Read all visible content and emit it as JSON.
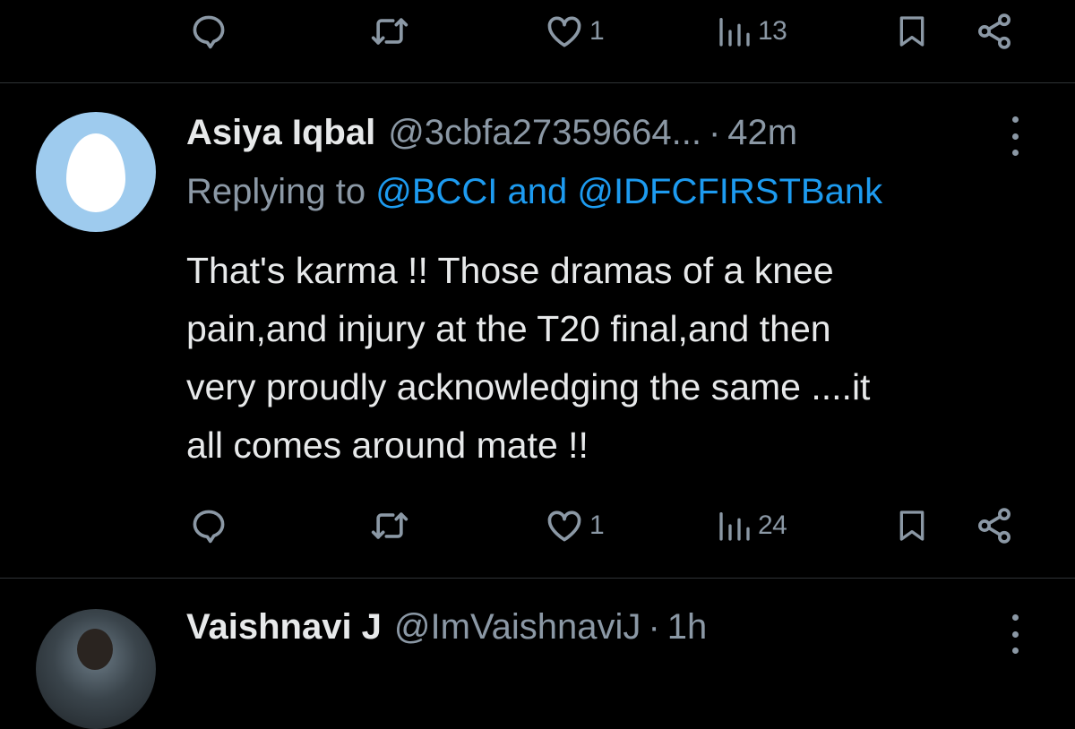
{
  "top_actions": {
    "reply_count": "",
    "retweet_count": "",
    "like_count": "1",
    "views_count": "13"
  },
  "tweet": {
    "author_name": "Asiya Iqbal",
    "handle": "@3cbfa27359664...",
    "separator": "·",
    "time": "42m",
    "replying_prefix": "Replying to",
    "mention_1": "@BCCI",
    "mention_joiner": "and",
    "mention_2": "@IDFCFIRSTBank",
    "body_lines": [
      "That's karma !! Those dramas of a knee",
      "pain,and injury at the T20 final,and then",
      "very proudly acknowledging the same ....it",
      "all comes around mate !!"
    ],
    "actions": {
      "reply_count": "",
      "retweet_count": "",
      "like_count": "1",
      "views_count": "24"
    }
  },
  "next_tweet": {
    "author_name": "Vaishnavi J",
    "handle": "@ImVaishnaviJ",
    "separator": "·",
    "time": "1h"
  },
  "colors": {
    "background": "#000000",
    "text_primary": "#e7e9ea",
    "text_secondary": "#8b98a5",
    "link": "#1d9bf0",
    "divider": "#2f3336",
    "egg_avatar_bg": "#9ecbee"
  },
  "icons": [
    "reply-icon",
    "retweet-icon",
    "like-icon",
    "views-icon",
    "bookmark-icon",
    "share-icon",
    "more-icon",
    "egg-avatar"
  ]
}
